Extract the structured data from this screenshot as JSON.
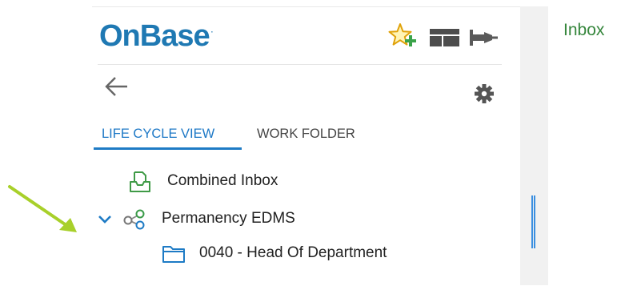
{
  "header": {
    "logo_text": "OnBase",
    "logo_mark": "·"
  },
  "tabs": [
    {
      "label": "LIFE CYCLE VIEW",
      "selected": true
    },
    {
      "label": "WORK FOLDER",
      "selected": false
    }
  ],
  "tree": {
    "combined_inbox": "Combined Inbox",
    "lifecycle": "Permanency EDMS",
    "queue": "0040 - Head Of Department"
  },
  "right_panel": {
    "title": "Inbox"
  },
  "colors": {
    "brand": "#1f79b3",
    "tab_active": "#1e7bc5",
    "inbox_title": "#35863c",
    "arrow_annotation": "#a8d02a"
  },
  "icons": {
    "favorite": "star-plus-icon",
    "layout": "layout-icon",
    "pin": "pin-icon",
    "back": "arrow-left-icon",
    "settings": "gear-icon",
    "inbox": "inbox-tray-icon",
    "expand": "chevron-down-icon",
    "lifecycle": "lifecycle-icon",
    "queue": "folder-icon",
    "annotation": "annotation-arrow-icon"
  }
}
